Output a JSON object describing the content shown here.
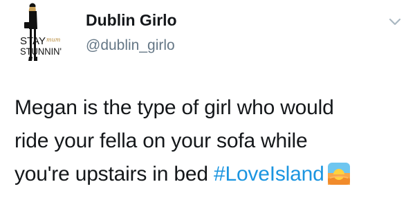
{
  "tweet": {
    "display_name": "Dublin Girlo",
    "handle": "@dublin_girlo",
    "avatar": {
      "icon": "stay-stunnin-logo-icon",
      "text_line1": "STAY",
      "text_line2": "STUNNIN'",
      "script_text": "mum"
    },
    "text_lines": [
      "Megan is the type of girl who would",
      "ride your fella on your sofa while"
    ],
    "last_line_prefix": "you're upstairs in bed ",
    "hashtag": "#LoveIsland",
    "emoji": "sunset-emoji-icon",
    "colors": {
      "text": "#14171a",
      "handle": "#657786",
      "hashtag": "#1b95e0",
      "caret": "#aab8c2"
    }
  }
}
